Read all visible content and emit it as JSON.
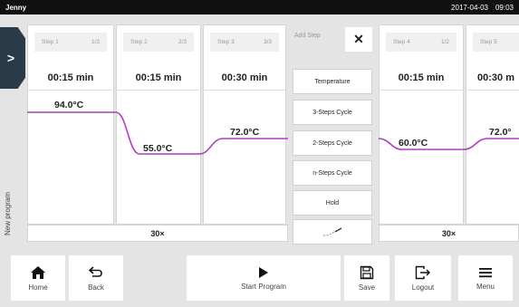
{
  "status": {
    "user": "Jenny",
    "date": "2017-04-03",
    "time": "09:03"
  },
  "sidebar": {
    "expand_glyph": ">",
    "label": "New program"
  },
  "steps": [
    {
      "label": "Step 1",
      "index": "1/3",
      "time": "00:15 min",
      "temp": "94.0°C"
    },
    {
      "label": "Step 2",
      "index": "2/3",
      "time": "00:15 min",
      "temp": "55.0°C"
    },
    {
      "label": "Step 3",
      "index": "3/3",
      "time": "00:30 min",
      "temp": "72.0°C"
    },
    {
      "label": "Step 4",
      "index": "1/2",
      "time": "00:15 min",
      "temp": "60.0°C"
    },
    {
      "label": "Step 5",
      "index": "",
      "time": "00:30 m",
      "temp": "72.0°"
    }
  ],
  "cycles": {
    "group1": "30×",
    "group2": "30×"
  },
  "add_step": {
    "title": "Add Step",
    "close": "✕",
    "options": [
      "Temperature",
      "3-Steps Cycle",
      "2-Steps Cycle",
      "n-Steps Cycle",
      "Hold"
    ]
  },
  "toolbar": {
    "home": "Home",
    "back": "Back",
    "start": "Start Program",
    "save": "Save",
    "logout": "Logout",
    "menu": "Menu"
  },
  "colors": {
    "curve": "#b03cc4",
    "status_bar": "#111111",
    "expand_tab": "#2b3a47"
  }
}
